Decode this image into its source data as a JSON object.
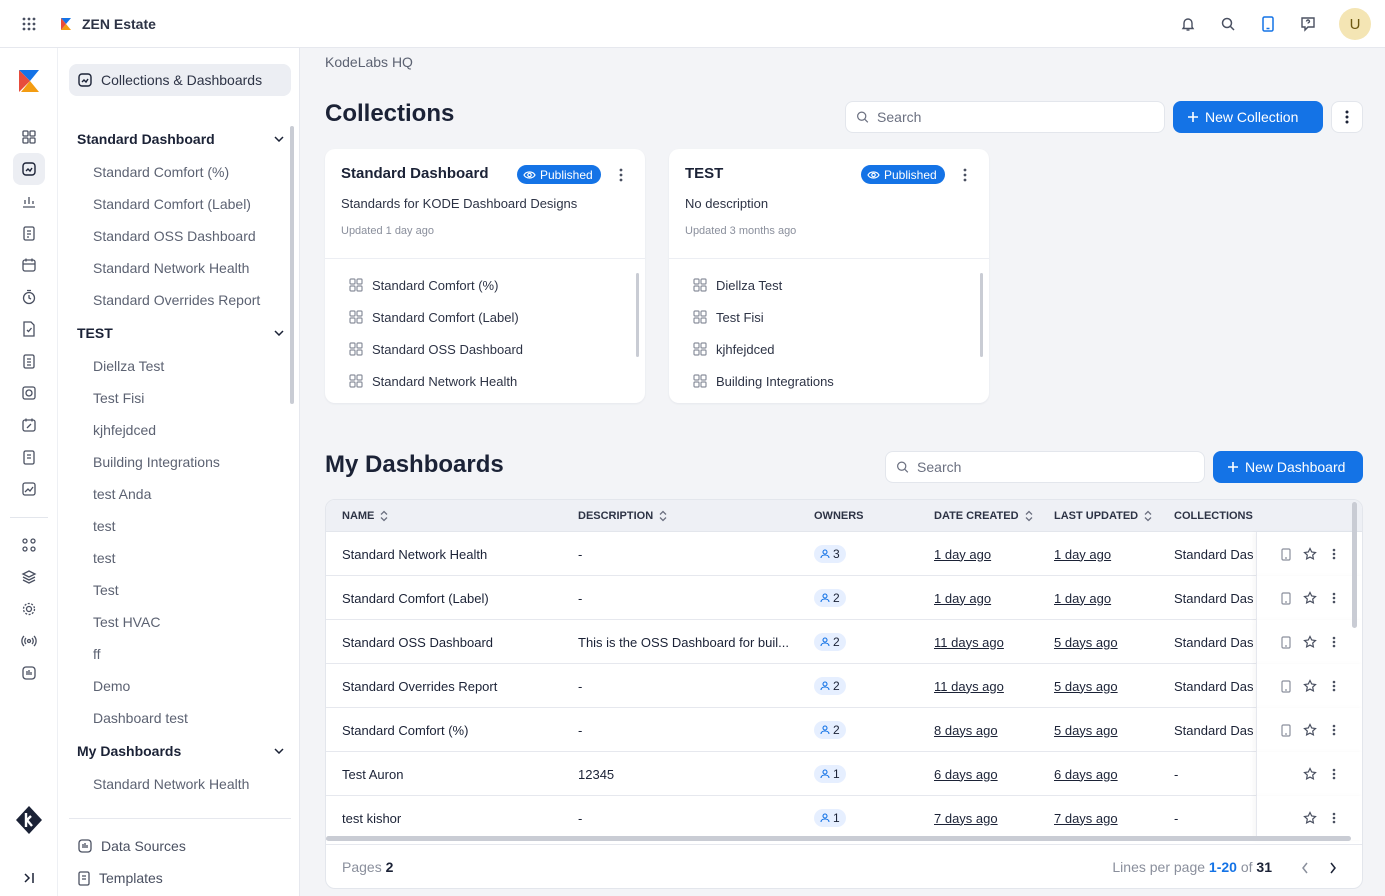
{
  "app": {
    "title": "ZEN Estate",
    "avatar_initial": "U",
    "accent": "#1473e6"
  },
  "topbar": {
    "icons": [
      "apps-grid-icon",
      "notification-bell-icon",
      "search-icon",
      "tablet-icon",
      "help-icon"
    ]
  },
  "rail": {
    "icons": [
      "dashboard-grid-icon",
      "collections-icon",
      "analytics-icon",
      "clipboard-icon",
      "calendar-icon",
      "timer-icon",
      "document-check-icon",
      "list-icon",
      "chart-box-icon",
      "calendar-edit-icon",
      "notes-icon",
      "trend-icon",
      "nodes-icon",
      "layers-icon",
      "settings-icon",
      "signal-icon",
      "data-bars-icon"
    ],
    "expand_label": ">|"
  },
  "nav": {
    "top_item": "Collections & Dashboards",
    "groups": [
      {
        "label": "Standard Dashboard",
        "items": [
          "Standard Comfort (%)",
          "Standard Comfort (Label)",
          "Standard OSS Dashboard",
          "Standard Network Health",
          "Standard Overrides Report"
        ]
      },
      {
        "label": "TEST",
        "items": [
          "Diellza Test",
          "Test Fisi",
          "kjhfejdced",
          "Building Integrations",
          "test Anda",
          "test",
          "test",
          "Test",
          "Test HVAC",
          "ff",
          "Demo",
          "Dashboard test"
        ]
      },
      {
        "label": "My Dashboards",
        "items": [
          "Standard Network Health"
        ]
      }
    ],
    "bottom": [
      "Data Sources",
      "Templates"
    ]
  },
  "main": {
    "breadcrumb": "KodeLabs HQ",
    "collections": {
      "title": "Collections",
      "search_placeholder": "Search",
      "new_label": "New Collection",
      "cards": [
        {
          "title": "Standard Dashboard",
          "badge": "Published",
          "description": "Standards for KODE Dashboard Designs",
          "updated": "Updated 1 day ago",
          "items": [
            "Standard Comfort (%)",
            "Standard Comfort (Label)",
            "Standard OSS Dashboard",
            "Standard Network Health"
          ]
        },
        {
          "title": "TEST",
          "badge": "Published",
          "description": "No description",
          "updated": "Updated 3 months ago",
          "items": [
            "Diellza Test",
            "Test Fisi",
            "kjhfejdced",
            "Building Integrations"
          ]
        }
      ]
    },
    "dashboards": {
      "title": "My Dashboards",
      "search_placeholder": "Search",
      "new_label": "New Dashboard",
      "columns": [
        "NAME",
        "DESCRIPTION",
        "OWNERS",
        "DATE CREATED",
        "LAST UPDATED",
        "COLLECTIONS"
      ],
      "rows": [
        {
          "name": "Standard Network Health",
          "description": "-",
          "owners": "3",
          "created": "1 day ago",
          "updated": "1 day ago",
          "collections": "Standard Das",
          "has_tablet": true
        },
        {
          "name": "Standard Comfort (Label)",
          "description": "-",
          "owners": "2",
          "created": "1 day ago",
          "updated": "1 day ago",
          "collections": "Standard Das",
          "has_tablet": true
        },
        {
          "name": "Standard OSS Dashboard",
          "description": "This is the OSS Dashboard for buil...",
          "owners": "2",
          "created": "11 days ago",
          "updated": "5 days ago",
          "collections": "Standard Das",
          "has_tablet": true
        },
        {
          "name": "Standard Overrides Report",
          "description": "-",
          "owners": "2",
          "created": "11 days ago",
          "updated": "5 days ago",
          "collections": "Standard Das",
          "has_tablet": true
        },
        {
          "name": "Standard Comfort (%)",
          "description": "-",
          "owners": "2",
          "created": "8 days ago",
          "updated": "5 days ago",
          "collections": "Standard Das",
          "has_tablet": true
        },
        {
          "name": "Test Auron",
          "description": "12345",
          "owners": "1",
          "created": "6 days ago",
          "updated": "6 days ago",
          "collections": "-",
          "has_tablet": false
        },
        {
          "name": "test kishor",
          "description": "-",
          "owners": "1",
          "created": "7 days ago",
          "updated": "7 days ago",
          "collections": "-",
          "has_tablet": false
        }
      ],
      "footer": {
        "pages_label": "Pages",
        "pages_value": "2",
        "lines_label": "Lines per page",
        "range": "1-20",
        "of_label": "of",
        "total": "31"
      }
    }
  }
}
